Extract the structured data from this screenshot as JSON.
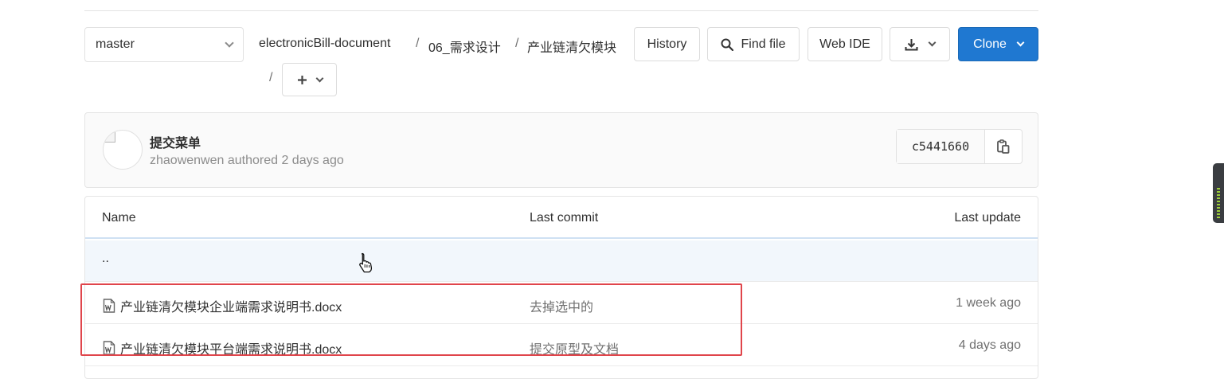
{
  "branch": {
    "selected": "master"
  },
  "breadcrumb": {
    "items": [
      "electronicBill-document",
      "06_需求设计",
      "产业链清欠模块"
    ],
    "separator": "/"
  },
  "toolbar": {
    "history_label": "History",
    "find_file_label": "Find file",
    "web_ide_label": "Web IDE",
    "clone_label": "Clone"
  },
  "last_commit": {
    "title": "提交菜单",
    "meta": "zhaowenwen authored 2 days ago",
    "sha": "c5441660"
  },
  "table": {
    "headers": {
      "name": "Name",
      "last_commit": "Last commit",
      "last_update": "Last update"
    },
    "parent_dir": "..",
    "rows": [
      {
        "name": "产业链清欠模块企业端需求说明书.docx",
        "commit": "去掉选中的",
        "updated": "1 week ago"
      },
      {
        "name": "产业链清欠模块平台端需求说明书.docx",
        "commit": "提交原型及文档",
        "updated": "4 days ago"
      }
    ]
  },
  "colors": {
    "accent": "#1f78d1",
    "highlight": "#e0454b"
  },
  "icons": [
    "chevron-down-icon",
    "search-icon",
    "download-icon",
    "plus-icon",
    "copy-icon",
    "word-file-icon",
    "pointer-cursor-icon"
  ]
}
